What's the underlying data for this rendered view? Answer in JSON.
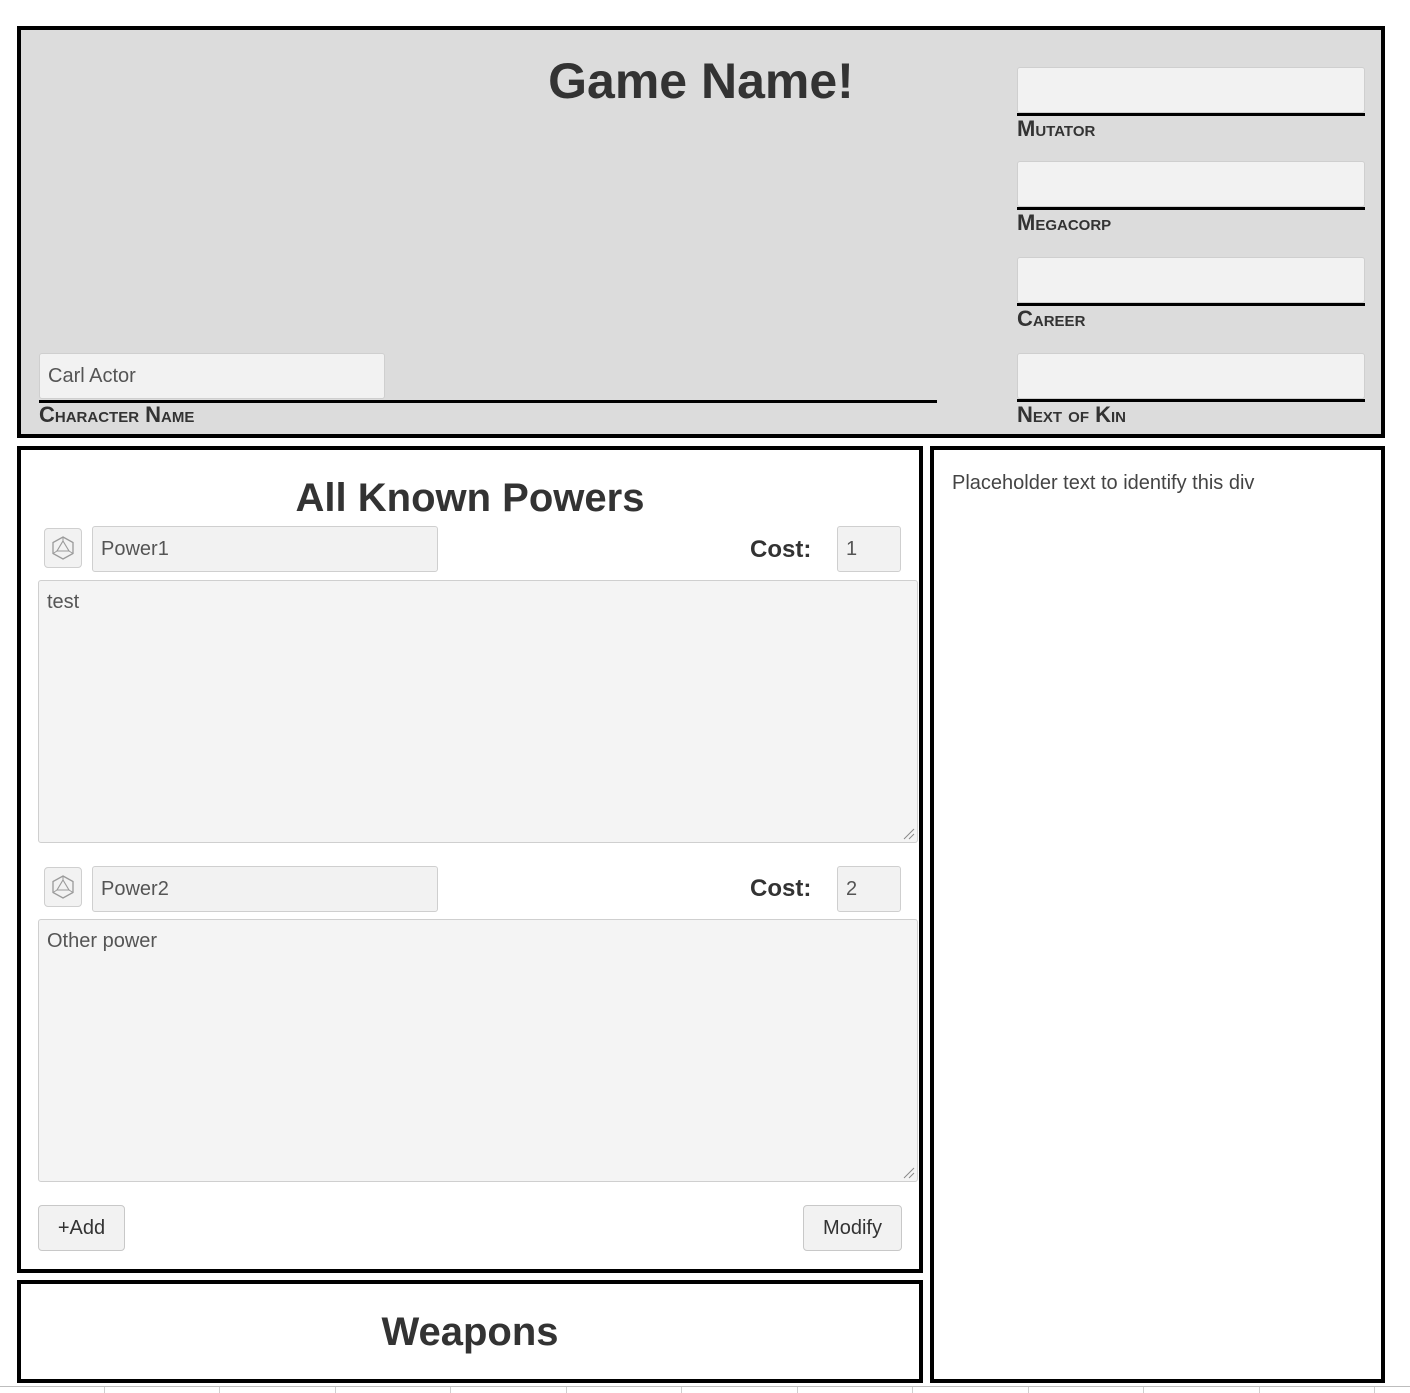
{
  "header": {
    "game_title": "Game Name!",
    "character_name": {
      "value": "Carl Actor",
      "label": "Character Name"
    },
    "fields": [
      {
        "label": "Mutator",
        "value": ""
      },
      {
        "label": "Megacorp",
        "value": ""
      },
      {
        "label": "Career",
        "value": ""
      },
      {
        "label": "Next of Kin",
        "value": ""
      }
    ]
  },
  "powers": {
    "title": "All Known Powers",
    "cost_label": "Cost:",
    "items": [
      {
        "name": "Power1",
        "cost": "1",
        "description": "test"
      },
      {
        "name": "Power2",
        "cost": "2",
        "description": "Other power"
      }
    ],
    "add_button": "+Add",
    "modify_button": "Modify"
  },
  "weapons": {
    "title": "Weapons"
  },
  "right_panel": {
    "text": "Placeholder text to identify this div"
  },
  "icons": {
    "dice": "d20-dice-icon",
    "resize": "resize-grip-icon"
  }
}
